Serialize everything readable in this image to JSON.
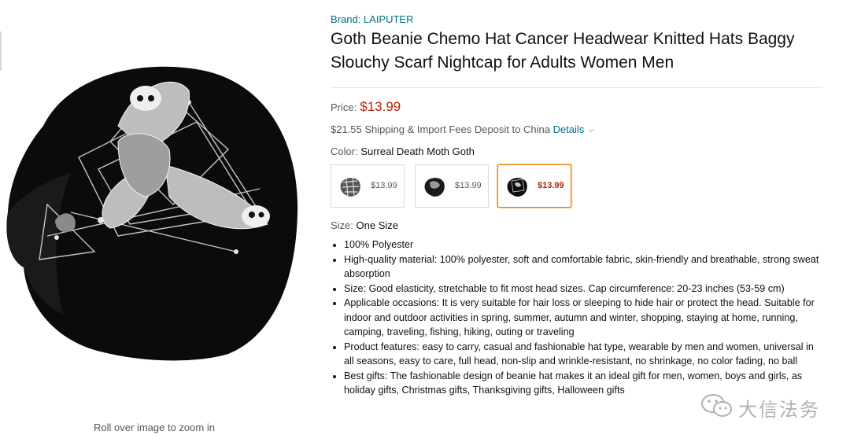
{
  "gallery": {
    "zoom_hint": "Roll over image to zoom in",
    "image_icon": "beanie-death-moth-image"
  },
  "product": {
    "brand": "Brand: LAIPUTER",
    "title": "Goth Beanie Chemo Hat Cancer Headwear Knitted Hats Baggy Slouchy Scarf Nightcap for Adults Women Men",
    "price_label": "Price:",
    "price": "$13.99",
    "shipping_text": "$21.55 Shipping & Import Fees Deposit to China",
    "shipping_link": "Details",
    "color_label": "Color:",
    "color_value": "Surreal Death Moth Goth",
    "swatches": [
      {
        "price": "$13.99",
        "selected": false
      },
      {
        "price": "$13.99",
        "selected": false
      },
      {
        "price": "$13.99",
        "selected": true
      }
    ],
    "size_label": "Size:",
    "size_value": "One Size",
    "bullets": [
      "100% Polyester",
      "High-quality material: 100% polyester, soft and comfortable fabric, skin-friendly and breathable, strong sweat absorption",
      "Size: Good elasticity, stretchable to fit most head sizes. Cap circumference: 20-23 inches (53-59 cm)",
      "Applicable occasions: It is very suitable for hair loss or sleeping to hide hair or protect the head. Suitable for indoor and outdoor activities in spring, summer, autumn and winter, shopping, staying at home, running, camping, traveling, fishing, hiking, outing or traveling",
      "Product features: easy to carry, casual and fashionable hat type, wearable by men and women, universal in all seasons, easy to care, full head, non-slip and wrinkle-resistant, no shrinkage, no color fading, no ball",
      "Best gifts: The fashionable design of beanie hat makes it an ideal gift for men, women, boys and girls, as holiday gifts, Christmas gifts, Thanksgiving gifts, Halloween gifts"
    ]
  },
  "watermark": {
    "text": "大信法务",
    "icon": "wechat-icon"
  },
  "colors": {
    "link": "#007185",
    "price": "#b12704",
    "selected_border": "#e77600"
  }
}
